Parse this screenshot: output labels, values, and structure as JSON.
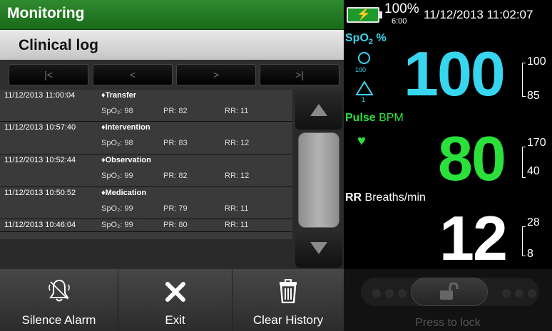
{
  "header": {
    "title": "Monitoring",
    "battery_percent": "100%",
    "battery_time": "6:00",
    "datetime": "11/12/2013 11:02:07"
  },
  "log": {
    "title": "Clinical log",
    "nav": {
      "first": "|<",
      "prev": "<",
      "next": ">",
      "last": ">|"
    },
    "entries": [
      {
        "time": "11/12/2013 11:00:04",
        "event": "♦Transfer",
        "spo2": "SpO₂: 98",
        "pr": "PR: 82",
        "rr": "RR: 11"
      },
      {
        "time": "11/12/2013 10:57:40",
        "event": "♦Intervention",
        "spo2": "SpO₂: 98",
        "pr": "PR: 83",
        "rr": "RR: 12"
      },
      {
        "time": "11/12/2013 10:52:44",
        "event": "♦Observation",
        "spo2": "SpO₂: 99",
        "pr": "PR: 82",
        "rr": "RR: 12"
      },
      {
        "time": "11/12/2013 10:50:52",
        "event": "♦Medication",
        "spo2": "SpO₂: 99",
        "pr": "PR: 79",
        "rr": "RR: 11"
      },
      {
        "time": "11/12/2013 10:46:04",
        "event": "",
        "spo2": "SpO₂: 99",
        "pr": "PR: 80",
        "rr": "RR: 11"
      }
    ]
  },
  "vitals": {
    "spo2": {
      "label": "SpO",
      "label_sub": "2",
      "label_unit": " %",
      "value": "100",
      "high": "100",
      "low": "85",
      "circle_value": "100",
      "triangle_value": "1",
      "color": "#37d6ee"
    },
    "pulse": {
      "label": "Pulse",
      "unit": " BPM",
      "value": "80",
      "high": "170",
      "low": "40",
      "color": "#29e13a"
    },
    "rr": {
      "label": "RR",
      "unit": " Breaths/min",
      "value": "12",
      "high": "28",
      "low": "8",
      "color": "#ffffff"
    }
  },
  "toolbar": {
    "silence_label": "Silence Alarm",
    "exit_label": "Exit",
    "clear_label": "Clear History",
    "lock_label": "Press to lock"
  }
}
